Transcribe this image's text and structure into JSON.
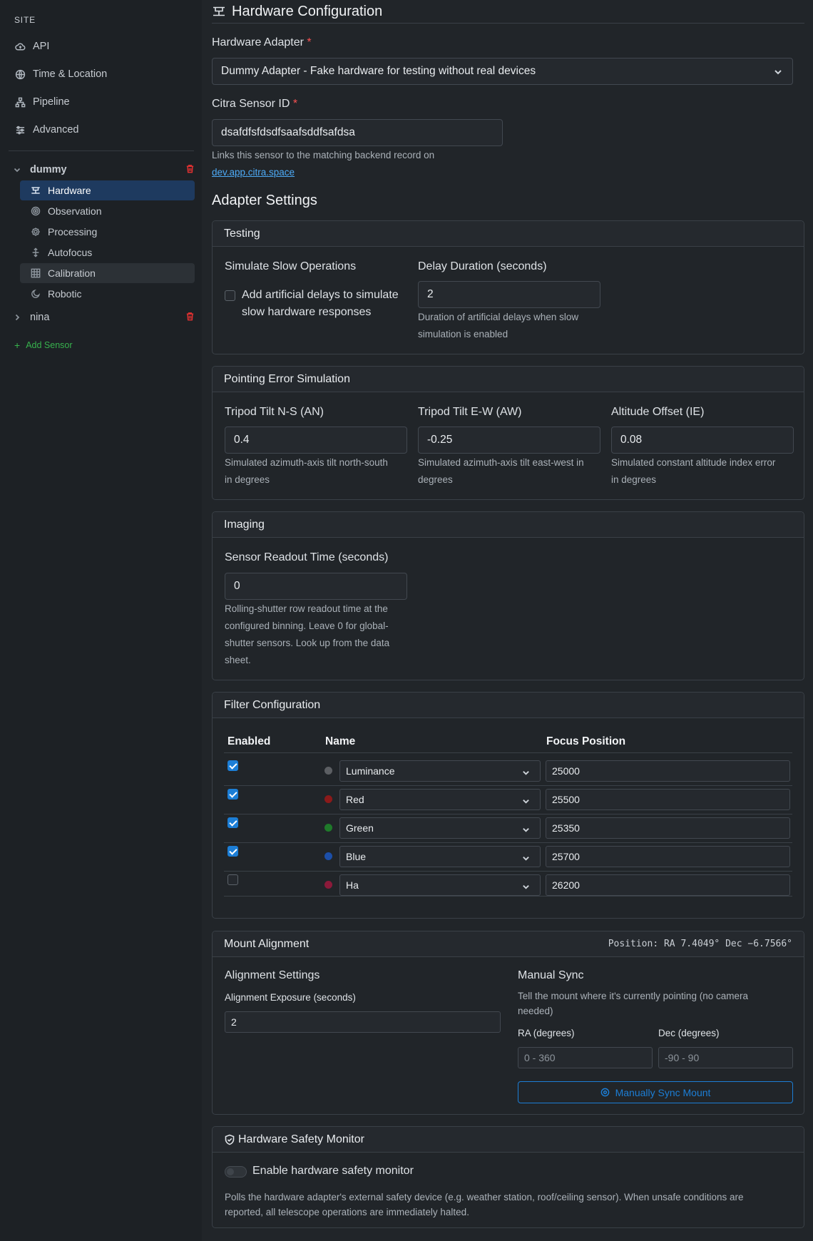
{
  "sidebar": {
    "site_label": "SITE",
    "site_items": [
      {
        "label": "API",
        "icon": "cloud-icon"
      },
      {
        "label": "Time & Location",
        "icon": "globe-icon"
      },
      {
        "label": "Pipeline",
        "icon": "pipeline-icon"
      },
      {
        "label": "Advanced",
        "icon": "sliders-icon"
      }
    ],
    "sensors": [
      {
        "name": "dummy",
        "expanded": true,
        "items": [
          {
            "label": "Hardware",
            "icon": "hardware-icon",
            "active": true
          },
          {
            "label": "Observation",
            "icon": "target-icon"
          },
          {
            "label": "Processing",
            "icon": "gear-icon"
          },
          {
            "label": "Autofocus",
            "icon": "focus-icon"
          },
          {
            "label": "Calibration",
            "icon": "grid-icon"
          },
          {
            "label": "Robotic",
            "icon": "moon-icon"
          }
        ]
      },
      {
        "name": "nina",
        "expanded": false
      }
    ],
    "add_sensor": "Add Sensor"
  },
  "header": {
    "title": "Hardware Configuration"
  },
  "hardware_adapter": {
    "label": "Hardware Adapter",
    "required_mark": "*",
    "value": "Dummy Adapter - Fake hardware for testing without real devices"
  },
  "sensor_id": {
    "label": "Citra Sensor ID",
    "required_mark": "*",
    "value": "dsafdfsfdsdfsaafsddfsafdsa",
    "help": "Links this sensor to the matching backend record on",
    "help_link": "dev.app.citra.space"
  },
  "adapter_settings_title": "Adapter Settings",
  "testing": {
    "title": "Testing",
    "slow_ops_label": "Simulate Slow Operations",
    "slow_ops_checkbox_label_line1": "Add artificial delays to simulate",
    "slow_ops_checkbox_label_line2": "slow hardware responses",
    "slow_ops_checked": false,
    "delay_label": "Delay Duration (seconds)",
    "delay_value": "2",
    "delay_help_line1": "Duration of artificial delays when slow",
    "delay_help_line2": "simulation is enabled"
  },
  "pointing": {
    "title": "Pointing Error Simulation",
    "fields": [
      {
        "label": "Tripod Tilt N-S (AN)",
        "value": "0.4",
        "help1": "Simulated azimuth-axis tilt north-south",
        "help2": "in degrees"
      },
      {
        "label": "Tripod Tilt E-W (AW)",
        "value": "-0.25",
        "help1": "Simulated azimuth-axis tilt east-west in",
        "help2": "degrees"
      },
      {
        "label": "Altitude Offset (IE)",
        "value": "0.08",
        "help1": "Simulated constant altitude index error",
        "help2": "in degrees"
      }
    ]
  },
  "imaging": {
    "title": "Imaging",
    "readout_label": "Sensor Readout Time (seconds)",
    "readout_value": "0",
    "help_lines": [
      "Rolling-shutter row readout time at the",
      "configured binning. Leave 0 for global-",
      "shutter sensors. Look up from the data",
      "sheet."
    ]
  },
  "filters": {
    "title": "Filter Configuration",
    "headers": {
      "enabled": "Enabled",
      "name": "Name",
      "focus": "Focus Position"
    },
    "rows": [
      {
        "enabled": true,
        "name": "Luminance",
        "focus": "25000",
        "color": "#5c5f63"
      },
      {
        "enabled": true,
        "name": "Red",
        "focus": "25500",
        "color": "#8b1a1a"
      },
      {
        "enabled": true,
        "name": "Green",
        "focus": "25350",
        "color": "#1f7a2a"
      },
      {
        "enabled": true,
        "name": "Blue",
        "focus": "25700",
        "color": "#1c4fa8"
      },
      {
        "enabled": false,
        "name": "Ha",
        "focus": "26200",
        "color": "#8b1a3a"
      }
    ]
  },
  "mount": {
    "title": "Mount Alignment",
    "position": "Position: RA 7.4049° Dec −6.7566°",
    "alignment_title": "Alignment Settings",
    "exposure_label": "Alignment Exposure (seconds)",
    "exposure_value": "2",
    "sync_title": "Manual Sync",
    "sync_help_line1": "Tell the mount where it's currently pointing (no camera",
    "sync_help_line2": "needed)",
    "ra_label": "RA (degrees)",
    "ra_placeholder": "0 - 360",
    "dec_label": "Dec (degrees)",
    "dec_placeholder": "-90 - 90",
    "sync_button": "Manually Sync Mount"
  },
  "safety": {
    "title": "Hardware Safety Monitor",
    "toggle_label": "Enable hardware safety monitor",
    "enabled": false,
    "help_line1": "Polls the hardware adapter's external safety device (e.g. weather station, roof/ceiling sensor). When unsafe conditions are",
    "help_line2": "reported, all telescope operations are immediately halted."
  },
  "colors": {
    "accent": "#1c7ed6",
    "active_nav": "#1e3a5f",
    "danger": "#e03131",
    "success": "#37b24d"
  }
}
